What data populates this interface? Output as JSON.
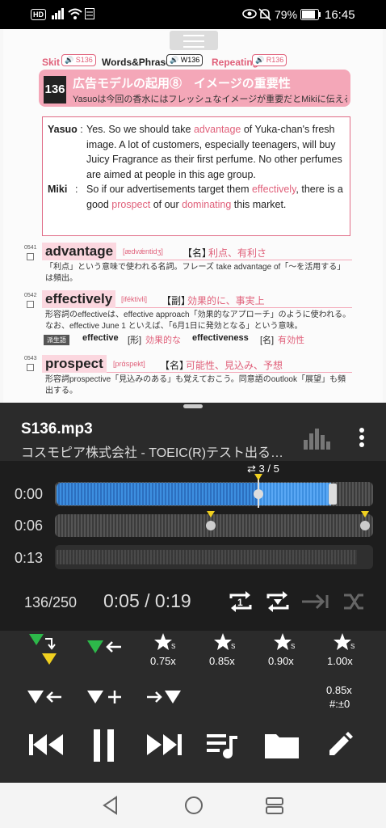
{
  "status": {
    "hd": "HD",
    "battery": "79%",
    "time": "16:45"
  },
  "doc": {
    "skit_label": "Skit",
    "skit_tag": "S136",
    "wp_label": "Words&Phrases",
    "wp_tag": "W136",
    "rep_label": "Repeating",
    "rep_tag": "R136",
    "number": "136",
    "title": "広告モデルの起用⑧　イメージの重要性",
    "subtitle": "Yasuoは今回の香水にはフレッシュなイメージが重要だとMikiに伝える。",
    "yasuo": "Yasuo",
    "miki": "Miki",
    "words": [
      {
        "no": "0541",
        "word": "advantage",
        "pron": "[ædvǽntidʒ]",
        "pos": "【名】",
        "meaning": "利点、有利さ",
        "note": "「利点」という意味で使われる名詞。フレーズ take advantage of「～を活用する」は頻出。"
      },
      {
        "no": "0542",
        "word": "effectively",
        "pron": "[iféktivli]",
        "pos": "【副】",
        "meaning": "効果的に、事実上",
        "note": "形容詞のeffectiveは、effective approach「効果的なアプローチ」のように使われる。なお、effective June 1 といえば、「6月1日に発効となる」という意味。",
        "derived": "派生語",
        "der1": "effective",
        "der1pos": "[形]",
        "der1m": "効果的な",
        "der2": "effectiveness",
        "der2pos": "[名]",
        "der2m": "有効性"
      },
      {
        "no": "0543",
        "word": "prospect",
        "pron": "[prάspekt]",
        "pos": "【名】",
        "meaning": "可能性、見込み、予想",
        "note": "形容詞prospective「見込みのある」も覚えておこう。同意語のoutlook「展望」も頻出する。"
      }
    ]
  },
  "player": {
    "title": "S136.mp3",
    "subtitle": "コスモピア株式会社 - TOEIC(R)テスト出る…",
    "repeat_count": "3 / 5",
    "times": [
      "0:00",
      "0:06",
      "0:13"
    ],
    "track_pos": "136/250",
    "progress": "0:05 / 0:19",
    "speeds": [
      "0.75x",
      "0.85x",
      "0.90x",
      "1.00x"
    ],
    "current_speed": "0.85x",
    "pitch": "#:±0",
    "playhead_fraction": 0.31
  }
}
